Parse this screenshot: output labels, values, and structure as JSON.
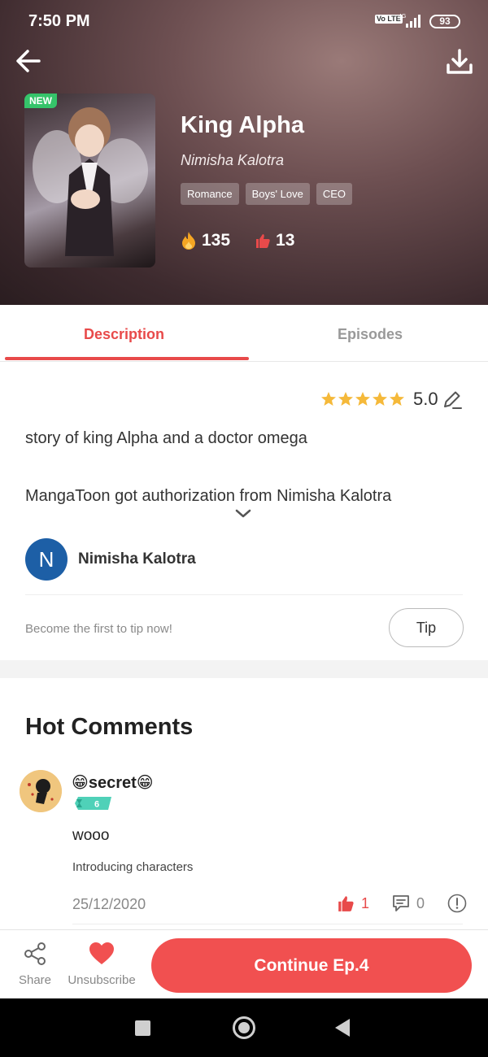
{
  "status_bar": {
    "time": "7:50 PM",
    "network": "4G",
    "volte": "Vo LTE",
    "battery": "93"
  },
  "book": {
    "badge": "NEW",
    "title": "King Alpha",
    "author": "Nimisha Kalotra",
    "tags": [
      "Romance",
      "Boys' Love",
      "CEO"
    ],
    "hot_count": "135",
    "like_count": "13"
  },
  "tabs": {
    "description": "Description",
    "episodes": "Episodes"
  },
  "description": {
    "rating": "5.0",
    "rating_stars": 5,
    "line1": "story of king Alpha and a doctor omega",
    "line2": "MangaToon got authorization from Nimisha Kalotra"
  },
  "author_card": {
    "initial": "N",
    "name": "Nimisha Kalotra"
  },
  "tip": {
    "prompt": "Become the first to tip now!",
    "button": "Tip"
  },
  "comments": {
    "title": "Hot Comments",
    "items": [
      {
        "user": "😁secret😁",
        "level": "6",
        "text": "wooo",
        "chapter": "Introducing characters",
        "date": "25/12/2020",
        "likes": "1",
        "replies": "0"
      }
    ]
  },
  "bottom_bar": {
    "share": "Share",
    "unsubscribe": "Unsubscribe",
    "continue": "Continue Ep.4"
  },
  "colors": {
    "accent": "#f15050",
    "tab_active": "#e84a4a",
    "star": "#f5b93a",
    "avatar_blue": "#1d5fa6",
    "badge_green": "#35c46a"
  }
}
